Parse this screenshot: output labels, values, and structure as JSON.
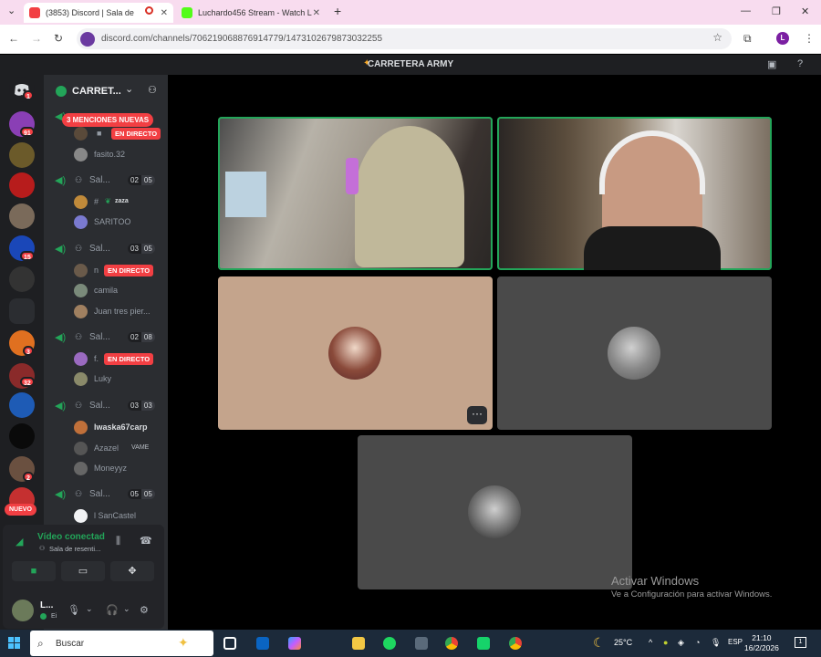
{
  "browser": {
    "tabs": [
      {
        "label": "(3853) Discord | Sala de"
      },
      {
        "label": "Luchardo456 Stream - Watch L"
      }
    ],
    "url": "discord.com/channels/706219068876914779/1473102679873032255",
    "profile_initial": "L"
  },
  "discord": {
    "title": "CARRETERA ARMY",
    "server_name": "CARRET...",
    "mentions_banner": "3 MENCIONES NUEVAS",
    "rail_badges": [
      "1",
      "91",
      "15",
      "3",
      "32",
      "2"
    ],
    "new_pill": "NUEVO",
    "live_label": "EN DIRECTO",
    "channels": [
      {
        "name": "Sal...",
        "count_a": "02",
        "count_b": "05",
        "members": [
          "",
          "fasito.32"
        ]
      },
      {
        "name": "Sal...",
        "count_a": "02",
        "count_b": "05",
        "members": [
          "#",
          "SARITOO"
        ]
      },
      {
        "name": "Sal...",
        "count_a": "03",
        "count_b": "05",
        "members": [
          "n",
          "camila",
          "Juan tres pier..."
        ]
      },
      {
        "name": "Sal...",
        "count_a": "02",
        "count_b": "08",
        "members": [
          "f.",
          "Luky"
        ]
      },
      {
        "name": "Sal...",
        "count_a": "03",
        "count_b": "03",
        "members": [
          "lwaska67carp",
          "Azazel",
          "Moneyyz"
        ]
      },
      {
        "name": "Sal...",
        "count_a": "05",
        "count_b": "05",
        "members": [
          "l SanCastel"
        ]
      }
    ],
    "member_tags": {
      "zaza": "zaza",
      "vame": "VAME"
    },
    "voice": {
      "status": "Vídeo conectad",
      "room": "Sala de resenti..."
    },
    "user": {
      "name": "L...",
      "status": "Ei"
    }
  },
  "windows_watermark": {
    "line1": "Activar Windows",
    "line2": "Ve a Configuración para activar Windows."
  },
  "taskbar": {
    "search": "Buscar",
    "weather": "25°C",
    "lang": "ESP",
    "time": "21:10",
    "date": "16/2/2026",
    "notif": "1"
  },
  "colors": {
    "accent_green": "#23a559",
    "live_red": "#f23f43",
    "discord_dark": "#1e1f22"
  }
}
